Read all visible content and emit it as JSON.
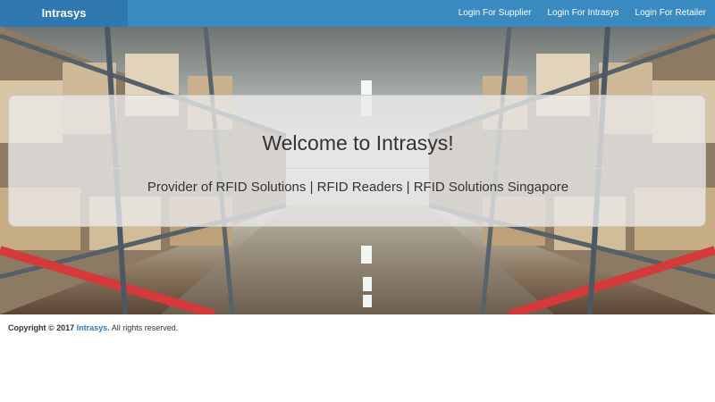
{
  "navbar": {
    "brand": "Intrasys",
    "links": [
      {
        "label": "Login For Supplier"
      },
      {
        "label": "Login For Intrasys"
      },
      {
        "label": "Login For Retailer"
      }
    ],
    "colors": {
      "bar": "#3a8ac2",
      "brand": "#2f79b0"
    }
  },
  "hero": {
    "title": "Welcome to Intrasys!",
    "subtitle": "Provider of RFID Solutions | RFID Readers | RFID Solutions Singapore"
  },
  "footer": {
    "prefix": "Copyright © 2017",
    "brand_link": "Intrasys.",
    "suffix": "All rights reserved."
  }
}
